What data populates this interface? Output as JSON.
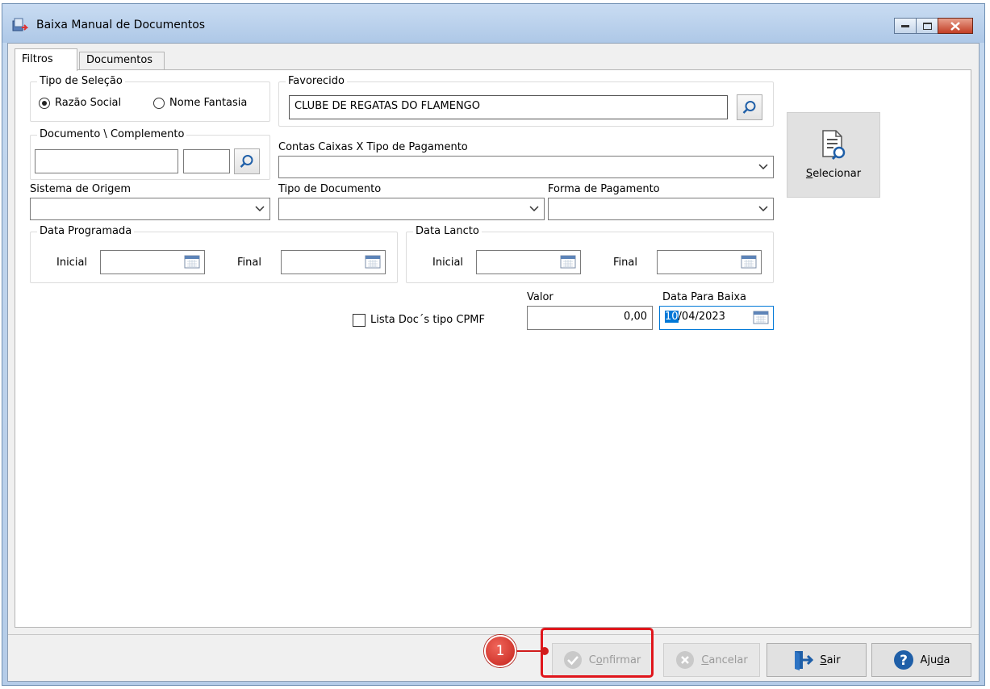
{
  "window": {
    "title": "Baixa Manual de Documentos"
  },
  "tabs": [
    {
      "label": "Filtros",
      "active": true
    },
    {
      "label": "Documentos",
      "active": false
    }
  ],
  "filtros": {
    "tipo_selecao": {
      "label": "Tipo de Seleção",
      "options": [
        {
          "label": "Razão Social",
          "checked": true
        },
        {
          "label": "Nome Fantasia",
          "checked": false
        }
      ]
    },
    "favorecido": {
      "label": "Favorecido",
      "value": "CLUBE DE REGATAS DO FLAMENGO"
    },
    "documento": {
      "label": "Documento \\ Complemento",
      "value": "",
      "complemento": ""
    },
    "contas_caixas": {
      "label": "Contas Caixas X Tipo de Pagamento",
      "value": ""
    },
    "sistema_origem": {
      "label": "Sistema de Origem",
      "value": ""
    },
    "tipo_documento": {
      "label": "Tipo de Documento",
      "value": ""
    },
    "forma_pagamento": {
      "label": "Forma de Pagamento",
      "value": ""
    },
    "data_programada": {
      "label": "Data Programada",
      "inicial_label": "Inicial",
      "final_label": "Final",
      "inicial": "",
      "final": ""
    },
    "data_lancto": {
      "label": "Data Lancto",
      "inicial_label": "Inicial",
      "final_label": "Final",
      "inicial": "",
      "final": ""
    },
    "lista_cpmf": {
      "label": "Lista Doc´s tipo CPMF",
      "checked": false
    },
    "valor": {
      "label": "Valor",
      "value": "0,00"
    },
    "data_baixa": {
      "label": "Data Para Baixa",
      "selected": "10",
      "rest": "/04/2023"
    },
    "selecionar_label": "elecionar",
    "selecionar_accel": "S"
  },
  "buttons": {
    "confirmar": {
      "accel": "o",
      "pre": "C",
      "post": "nfirmar",
      "enabled": false
    },
    "cancelar": {
      "accel": "C",
      "post": "ancelar",
      "enabled": false
    },
    "sair": {
      "accel": "S",
      "post": "air"
    },
    "ajuda": {
      "pre": "Aju",
      "accel": "d",
      "post": "a"
    }
  },
  "annotation": {
    "number": "1"
  },
  "colors": {
    "accent_red": "#e0161c",
    "selection_blue": "#0078d7"
  }
}
